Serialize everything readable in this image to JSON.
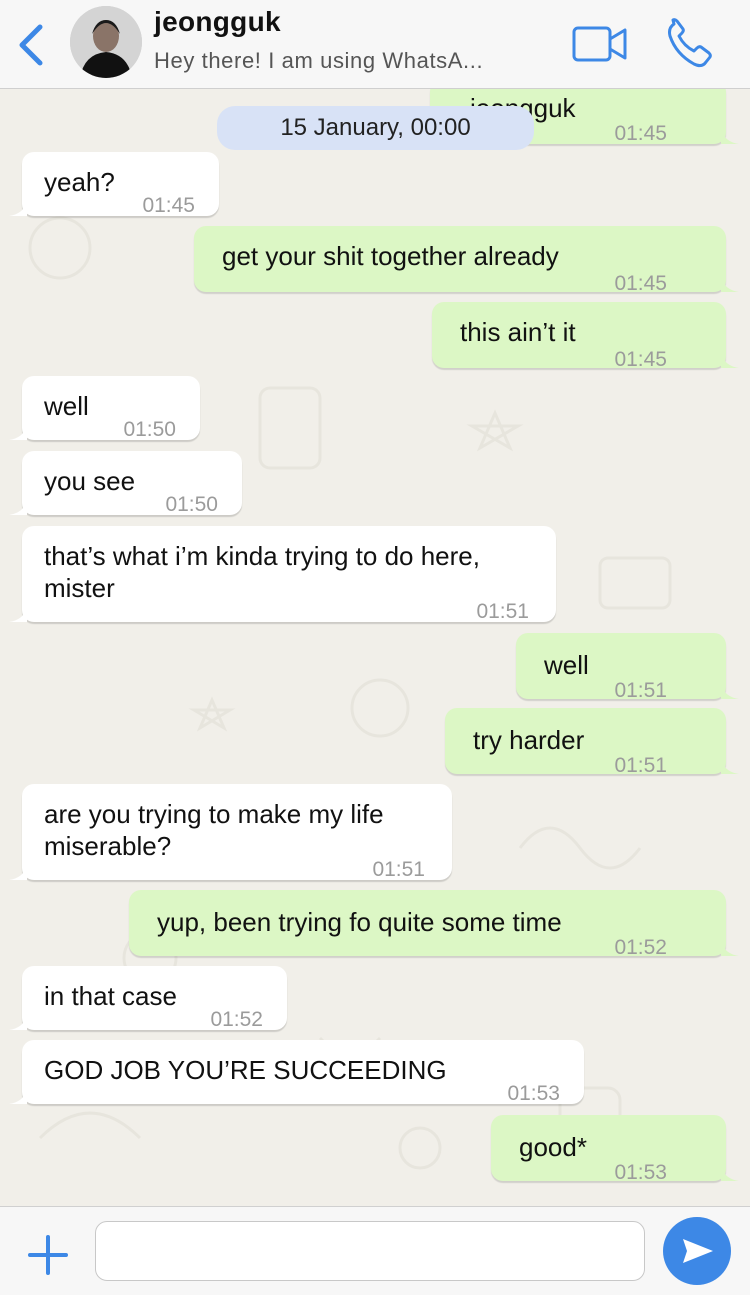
{
  "header": {
    "contact_name": "jeongguk",
    "status": "Hey there! I am using WhatsA..."
  },
  "date_chip": "15 January, 00:00",
  "messages": [
    {
      "dir": "out",
      "text": "jeongguk",
      "time": "01:45"
    },
    {
      "dir": "in",
      "text": "yeah?",
      "time": "01:45"
    },
    {
      "dir": "out",
      "text": "get your shit together already",
      "time": "01:45"
    },
    {
      "dir": "out",
      "text": "this ain’t it",
      "time": "01:45"
    },
    {
      "dir": "in",
      "text": "well",
      "time": "01:50"
    },
    {
      "dir": "in",
      "text": "you see",
      "time": "01:50"
    },
    {
      "dir": "in",
      "text": "that’s what i’m kinda trying to do here,",
      "text2": "mister",
      "time": "01:51"
    },
    {
      "dir": "out",
      "text": "well",
      "time": "01:51"
    },
    {
      "dir": "out",
      "text": "try harder",
      "time": "01:51"
    },
    {
      "dir": "in",
      "text": "are you trying to make my life",
      "text2": "miserable?",
      "time": "01:51"
    },
    {
      "dir": "out",
      "text": "yup, been trying fo quite some time",
      "time": "01:52"
    },
    {
      "dir": "in",
      "text": "in that case",
      "time": "01:52"
    },
    {
      "dir": "in",
      "text": "GOD JOB YOU’RE SUCCEEDING",
      "time": "01:53"
    },
    {
      "dir": "out",
      "text": "good*",
      "time": "01:53"
    }
  ],
  "input": {
    "value": "",
    "placeholder": ""
  },
  "icons": {
    "back": "chevron-left-icon",
    "video": "video-camera-icon",
    "call": "phone-icon",
    "attach": "plus-icon",
    "send": "send-icon"
  },
  "colors": {
    "accent": "#3d88e6",
    "outgoing_bubble": "#dcf7c5",
    "incoming_bubble": "#ffffff",
    "date_chip": "#d8e2f6"
  }
}
